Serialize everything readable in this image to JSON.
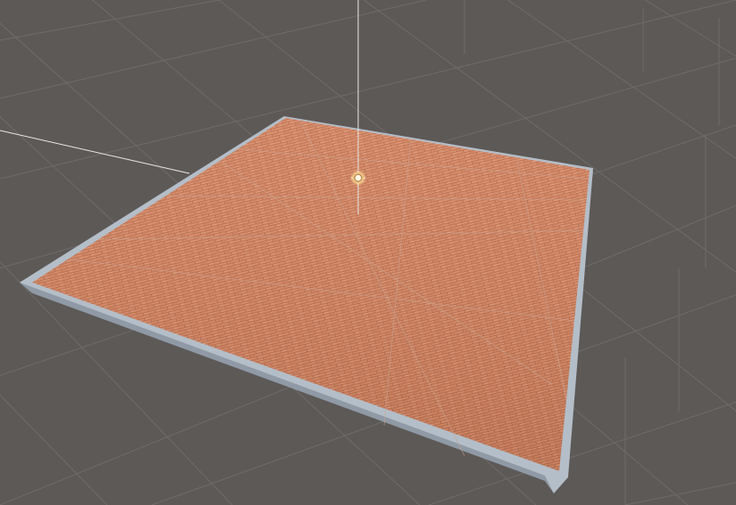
{
  "scene": {
    "background_color": "#5d5957",
    "grid_color": "#6f6b68",
    "floor": {
      "brick_color": "#d98c68",
      "mortar_color": "#b5694b",
      "tile_grid_color": "#c9a390",
      "border_color": "#8f9aa6",
      "border_top_color": "#b4bec8"
    },
    "gizmo": {
      "light_icon": "sun-icon",
      "line_color": "#e8e8e8"
    }
  }
}
